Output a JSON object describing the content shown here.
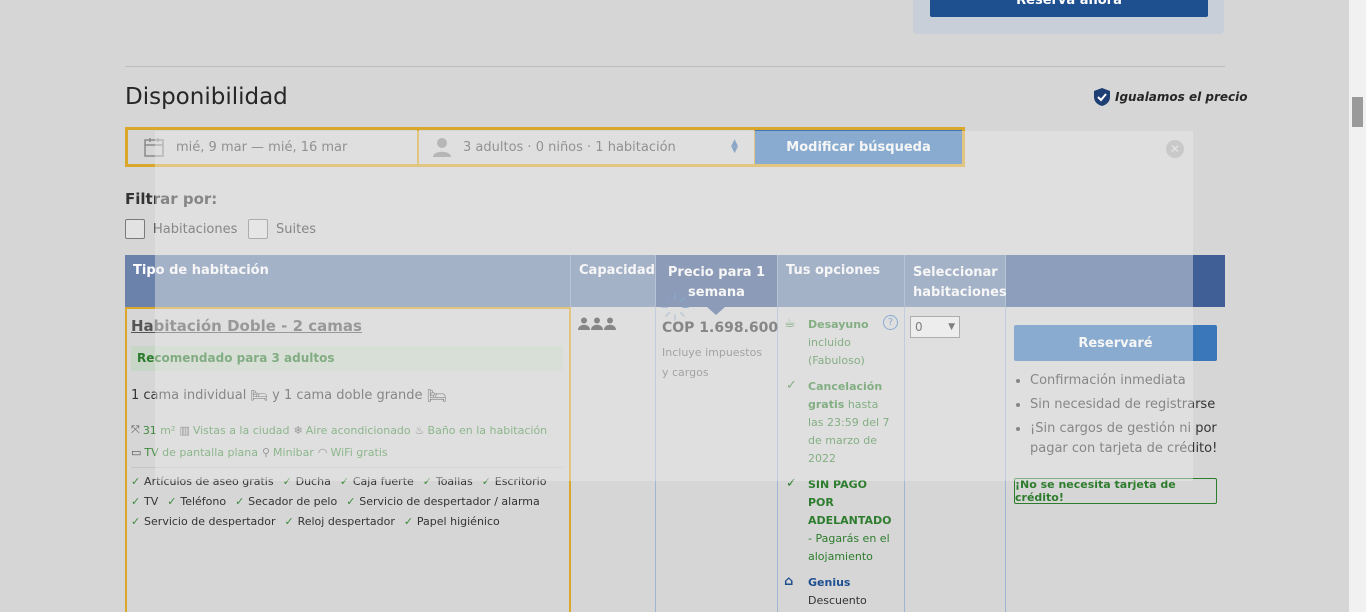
{
  "top": {
    "reserve_now": "Reserva ahora"
  },
  "section": {
    "title": "Disponibilidad",
    "price_match": "Igualamos el precio"
  },
  "search": {
    "dates": "mié, 9 mar — mié, 16 mar",
    "guests": "3 adultos  ·  0 niños  ·  1 habitación",
    "button": "Modificar búsqueda"
  },
  "filter": {
    "label": "Filtrar por:",
    "options": [
      "Habitaciones",
      "Suites"
    ]
  },
  "table": {
    "headers": [
      "Tipo de habitación",
      "Capacidad",
      "Precio para 1 semana",
      "Tus opciones",
      "Seleccionar habitaciones"
    ]
  },
  "room": {
    "name": "Habitación Doble - 2 camas",
    "recommended": "Recomendado para 3 adultos",
    "beds_a": "1 cama individual",
    "beds_and": "y 1 cama doble grande",
    "amenities_row1": [
      "31 m²",
      "Vistas a la ciudad",
      "Aire acondicionado",
      "Baño en la habitación"
    ],
    "amenities_row2": [
      "TV de pantalla plana",
      "Minibar",
      "WiFi gratis"
    ],
    "facilities_row1": [
      "Artículos de aseo gratis",
      "Ducha",
      "Caja fuerte",
      "Toallas",
      "Escritorio"
    ],
    "facilities_row2": [
      "TV",
      "Teléfono",
      "Secador de pelo",
      "Servicio de despertador / alarma"
    ],
    "facilities_row3": [
      "Servicio de despertador",
      "Reloj despertador",
      "Papel higiénico"
    ],
    "price": "COP 1.698.600",
    "price_note": "Incluye impuestos y cargos",
    "options": {
      "breakfast_title": "Desayuno",
      "breakfast_detail": "incluido (Fabuloso)",
      "cancel_title": "Cancelación gratis",
      "cancel_detail": "hasta las 23:59 del 7 de marzo de 2022",
      "nopay_title": "SIN PAGO POR ADELANTADO",
      "nopay_detail": "- Pagarás en el alojamiento",
      "genius_title": "Genius",
      "genius_detail": "Descuento"
    },
    "select_value": "0",
    "reserve_button": "Reservaré",
    "bullets": [
      "Confirmación inmediata",
      "Sin necesidad de registrarse",
      "¡Sin cargos de gestión ni por pagar con tarjeta de crédito!"
    ],
    "no_card": "¡No se necesita tarjeta de crédito!"
  },
  "colors": {
    "brand_blue": "#3a77ba",
    "header_blue": "#6b83ab",
    "highlight": "#d9a72a",
    "green": "#2e7d2e"
  }
}
